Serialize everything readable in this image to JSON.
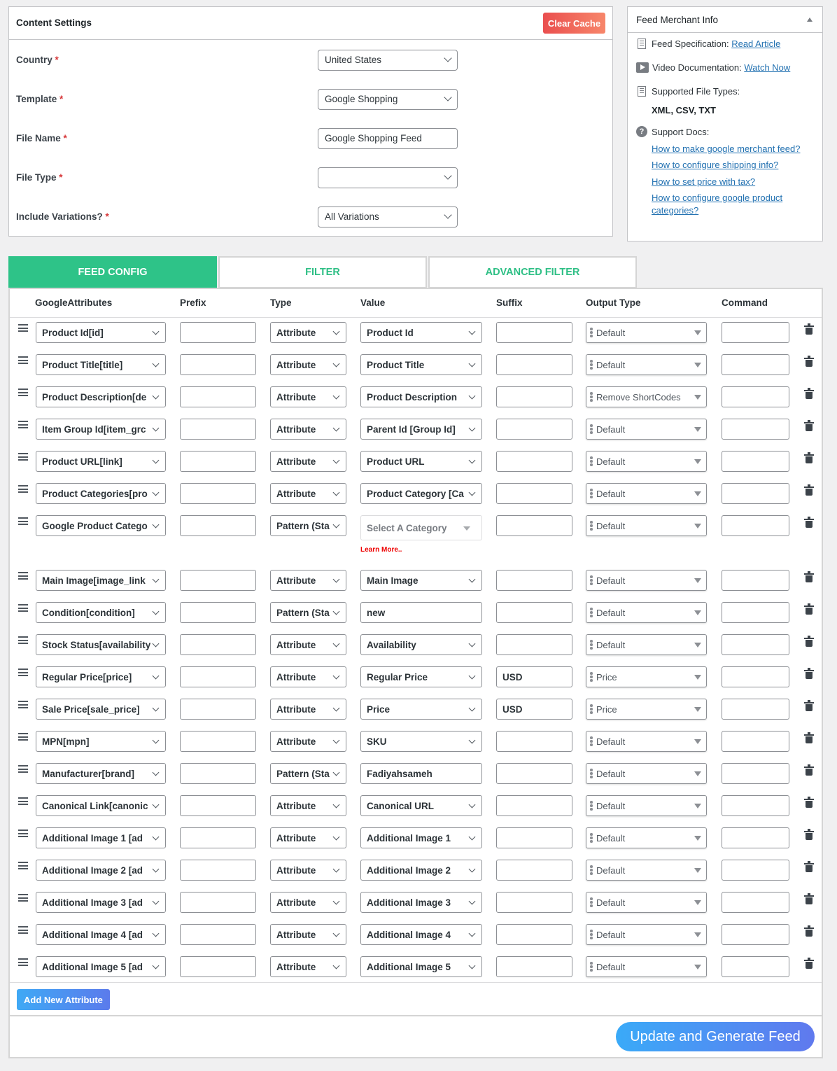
{
  "content_settings": {
    "title": "Content Settings",
    "clear_cache_label": "Clear Cache",
    "required_mark": "*",
    "fields": [
      {
        "label": "Country",
        "value": "United States",
        "kind": "select"
      },
      {
        "label": "Template",
        "value": "Google Shopping",
        "kind": "select"
      },
      {
        "label": "File Name",
        "value": "Google Shopping Feed",
        "kind": "input"
      },
      {
        "label": "File Type",
        "value": "",
        "kind": "select"
      },
      {
        "label": "Include Variations?",
        "value": "All Variations",
        "kind": "select"
      }
    ]
  },
  "merchant_info": {
    "title": "Feed Merchant Info",
    "feed_spec_label": "Feed Specification:",
    "feed_spec_link": "Read Article",
    "video_label": "Video Documentation:",
    "video_link": "Watch Now",
    "file_types_label": "Supported File Types:",
    "file_types_value": "XML, CSV, TXT",
    "support_docs_label": "Support Docs:",
    "support_links": [
      "How to make google merchant feed?",
      "How to configure shipping info?",
      "How to set price with tax?",
      "How to configure google product categories?"
    ]
  },
  "tabs": [
    {
      "label": "FEED CONFIG",
      "active": true
    },
    {
      "label": "FILTER",
      "active": false
    },
    {
      "label": "ADVANCED FILTER",
      "active": false
    }
  ],
  "feed_config": {
    "columns": [
      "GoogleAttributes",
      "Prefix",
      "Type",
      "Value",
      "Suffix",
      "Output Type",
      "Command"
    ],
    "rows": [
      {
        "attribute": "Product Id[id]",
        "prefix": "",
        "type": "Attribute",
        "value": "Product Id",
        "value_kind": "select",
        "suffix": "",
        "output": "Default",
        "command": ""
      },
      {
        "attribute": "Product Title[title]",
        "prefix": "",
        "type": "Attribute",
        "value": "Product Title",
        "value_kind": "select",
        "suffix": "",
        "output": "Default",
        "command": ""
      },
      {
        "attribute": "Product Description[de",
        "prefix": "",
        "type": "Attribute",
        "value": "Product Description",
        "value_kind": "select",
        "suffix": "",
        "output": "Remove ShortCodes",
        "command": ""
      },
      {
        "attribute": "Item Group Id[item_grc",
        "prefix": "",
        "type": "Attribute",
        "value": "Parent Id [Group Id]",
        "value_kind": "select",
        "suffix": "",
        "output": "Default",
        "command": ""
      },
      {
        "attribute": "Product URL[link]",
        "prefix": "",
        "type": "Attribute",
        "value": "Product URL",
        "value_kind": "select",
        "suffix": "",
        "output": "Default",
        "command": ""
      },
      {
        "attribute": "Product Categories[pro",
        "prefix": "",
        "type": "Attribute",
        "value": "Product Category [Ca",
        "value_kind": "select",
        "suffix": "",
        "output": "Default",
        "command": ""
      },
      {
        "attribute": "Google Product Catego",
        "prefix": "",
        "type": "Pattern (Sta",
        "value": "Select A Category",
        "value_kind": "category",
        "learn_more": "Learn More..",
        "suffix": "",
        "output": "Default",
        "command": ""
      },
      {
        "attribute": "Main Image[image_link",
        "prefix": "",
        "type": "Attribute",
        "value": "Main Image",
        "value_kind": "select",
        "suffix": "",
        "output": "Default",
        "command": ""
      },
      {
        "attribute": "Condition[condition]",
        "prefix": "",
        "type": "Pattern (Sta",
        "value": "new",
        "value_kind": "input",
        "suffix": "",
        "output": "Default",
        "command": ""
      },
      {
        "attribute": "Stock Status[availability",
        "prefix": "",
        "type": "Attribute",
        "value": "Availability",
        "value_kind": "select",
        "suffix": "",
        "output": "Default",
        "command": ""
      },
      {
        "attribute": "Regular Price[price]",
        "prefix": "",
        "type": "Attribute",
        "value": "Regular Price",
        "value_kind": "select",
        "suffix": "USD",
        "output": "Price",
        "command": ""
      },
      {
        "attribute": "Sale Price[sale_price]",
        "prefix": "",
        "type": "Attribute",
        "value": "Price",
        "value_kind": "select",
        "suffix": "USD",
        "output": "Price",
        "command": ""
      },
      {
        "attribute": "MPN[mpn]",
        "prefix": "",
        "type": "Attribute",
        "value": "SKU",
        "value_kind": "select",
        "suffix": "",
        "output": "Default",
        "command": ""
      },
      {
        "attribute": "Manufacturer[brand]",
        "prefix": "",
        "type": "Pattern (Sta",
        "value": "Fadiyahsameh",
        "value_kind": "input",
        "suffix": "",
        "output": "Default",
        "command": ""
      },
      {
        "attribute": "Canonical Link[canonic",
        "prefix": "",
        "type": "Attribute",
        "value": "Canonical URL",
        "value_kind": "select",
        "suffix": "",
        "output": "Default",
        "command": ""
      },
      {
        "attribute": "Additional Image 1 [ad",
        "prefix": "",
        "type": "Attribute",
        "value": "Additional Image 1",
        "value_kind": "select",
        "suffix": "",
        "output": "Default",
        "command": ""
      },
      {
        "attribute": "Additional Image 2 [ad",
        "prefix": "",
        "type": "Attribute",
        "value": "Additional Image 2",
        "value_kind": "select",
        "suffix": "",
        "output": "Default",
        "command": ""
      },
      {
        "attribute": "Additional Image 3 [ad",
        "prefix": "",
        "type": "Attribute",
        "value": "Additional Image 3",
        "value_kind": "select",
        "suffix": "",
        "output": "Default",
        "command": ""
      },
      {
        "attribute": "Additional Image 4 [ad",
        "prefix": "",
        "type": "Attribute",
        "value": "Additional Image 4",
        "value_kind": "select",
        "suffix": "",
        "output": "Default",
        "command": ""
      },
      {
        "attribute": "Additional Image 5 [ad",
        "prefix": "",
        "type": "Attribute",
        "value": "Additional Image 5",
        "value_kind": "select",
        "suffix": "",
        "output": "Default",
        "command": ""
      }
    ],
    "add_attribute_label": "Add New Attribute",
    "generate_label": "Update and Generate Feed"
  }
}
